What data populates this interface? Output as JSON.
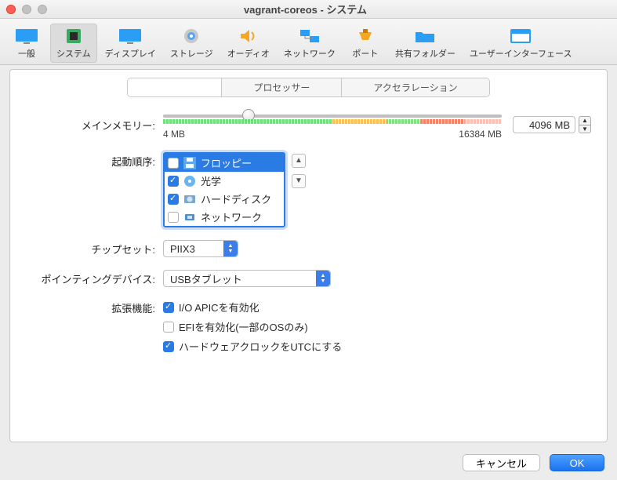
{
  "window": {
    "title": "vagrant-coreos - システム"
  },
  "toolbar": [
    {
      "id": "general",
      "label": "一般"
    },
    {
      "id": "system",
      "label": "システム"
    },
    {
      "id": "display",
      "label": "ディスプレイ"
    },
    {
      "id": "storage",
      "label": "ストレージ"
    },
    {
      "id": "audio",
      "label": "オーディオ"
    },
    {
      "id": "network",
      "label": "ネットワーク"
    },
    {
      "id": "ports",
      "label": "ポート"
    },
    {
      "id": "shared",
      "label": "共有フォルダー"
    },
    {
      "id": "ui",
      "label": "ユーザーインターフェース"
    }
  ],
  "subtabs": {
    "motherboard": "",
    "processor": "プロセッサー",
    "acceleration": "アクセラレーション"
  },
  "labels": {
    "memory": "メインメモリー:",
    "bootorder": "起動順序:",
    "chipset": "チップセット:",
    "pointing": "ポインティングデバイス:",
    "extended": "拡張機能:"
  },
  "memory": {
    "value": "4096 MB",
    "min": "4 MB",
    "max": "16384 MB"
  },
  "boot": {
    "items": [
      {
        "label": "フロッピー",
        "checked": false,
        "selected": true,
        "icon": "floppy"
      },
      {
        "label": "光学",
        "checked": true,
        "selected": false,
        "icon": "optical"
      },
      {
        "label": "ハードディスク",
        "checked": true,
        "selected": false,
        "icon": "hdd"
      },
      {
        "label": "ネットワーク",
        "checked": false,
        "selected": false,
        "icon": "net"
      }
    ]
  },
  "chipset": {
    "value": "PIIX3"
  },
  "pointing": {
    "value": "USBタブレット"
  },
  "ext": {
    "ioapic": {
      "label": "I/O APICを有効化",
      "checked": true
    },
    "efi": {
      "label": "EFIを有効化(一部のOSのみ)",
      "checked": false
    },
    "utc": {
      "label": "ハードウェアクロックをUTCにする",
      "checked": true
    }
  },
  "buttons": {
    "cancel": "キャンセル",
    "ok": "OK"
  }
}
